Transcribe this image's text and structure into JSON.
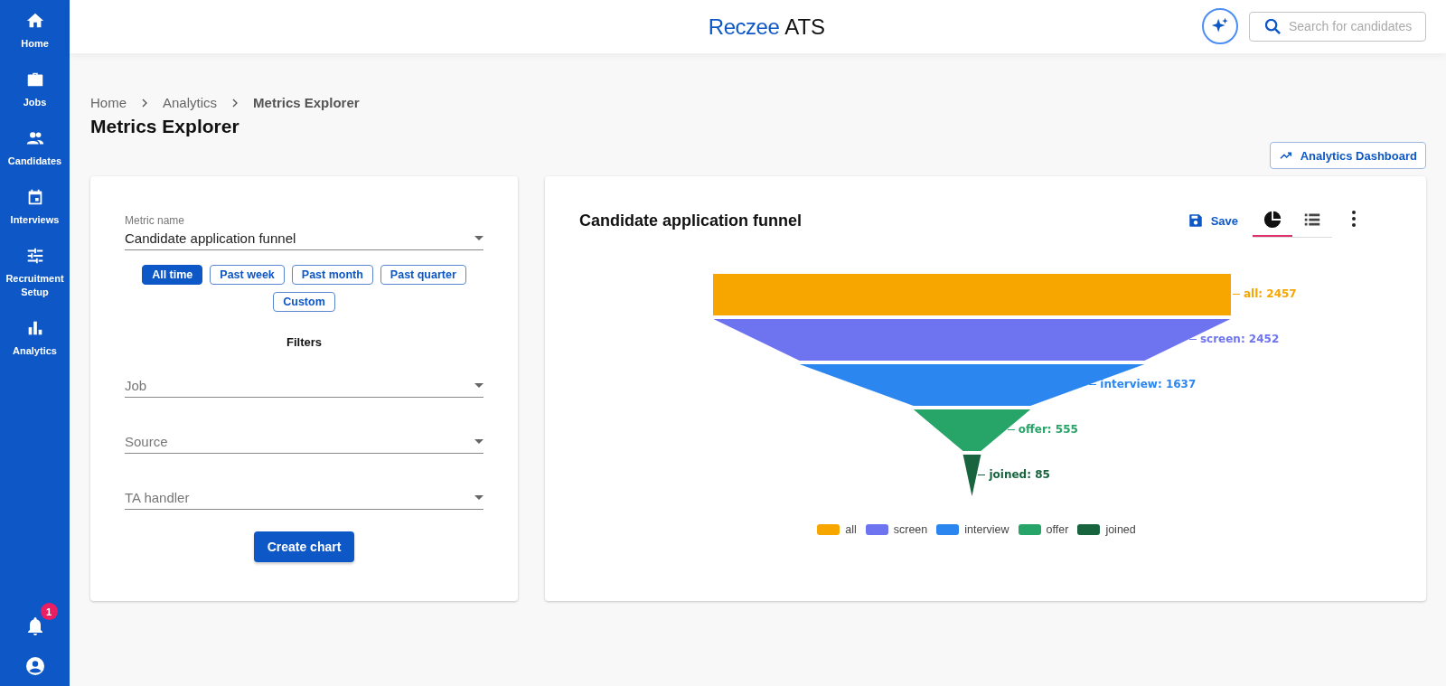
{
  "sidebar": {
    "items": [
      {
        "label": "Home",
        "kind": "home"
      },
      {
        "label": "Jobs",
        "kind": "jobs"
      },
      {
        "label": "Candidates",
        "kind": "candidates"
      },
      {
        "label": "Interviews",
        "kind": "interviews"
      },
      {
        "label": "Recruitment Setup",
        "kind": "setup"
      },
      {
        "label": "Analytics",
        "kind": "analytics"
      }
    ],
    "notifications": {
      "badge": "1"
    }
  },
  "header": {
    "logo": {
      "brand": "Reczee",
      "product": "ATS"
    },
    "search": {
      "placeholder": "Search for candidates"
    }
  },
  "breadcrumb": [
    {
      "label": "Home",
      "current": false
    },
    {
      "label": "Analytics",
      "current": false
    },
    {
      "label": "Metrics Explorer",
      "current": true
    }
  ],
  "page_title": "Metrics Explorer",
  "dashboard_button": "Analytics Dashboard",
  "metric_form": {
    "metric_field": {
      "label": "Metric name",
      "value": "Candidate application funnel"
    },
    "ranges": [
      {
        "label": "All time",
        "selected": true
      },
      {
        "label": "Past week",
        "selected": false
      },
      {
        "label": "Past month",
        "selected": false
      },
      {
        "label": "Past quarter",
        "selected": false
      },
      {
        "label": "Custom",
        "selected": false
      }
    ],
    "filters_title": "Filters",
    "filters": [
      {
        "placeholder": "Job"
      },
      {
        "placeholder": "Source"
      },
      {
        "placeholder": "TA handler"
      }
    ],
    "submit": "Create chart"
  },
  "chart_panel": {
    "title": "Candidate application funnel",
    "save": "Save",
    "view_tabs": [
      {
        "kind": "chart",
        "selected": true
      },
      {
        "kind": "table",
        "selected": false
      }
    ],
    "funnel": {
      "stages": [
        {
          "kind": "bar",
          "label": "all: 2457",
          "color": "#f7a600"
        },
        {
          "kind": "taper",
          "label": "screen: 2452",
          "color": "#6e74ef"
        },
        {
          "kind": "taper",
          "label": "interview: 1637",
          "color": "#2b86f0"
        },
        {
          "kind": "taper",
          "label": "offer: 555",
          "color": "#27a468"
        },
        {
          "kind": "taper",
          "label": "joined: 85",
          "color": "#17643f"
        }
      ],
      "legend": [
        {
          "label": "all",
          "color": "#f7a600"
        },
        {
          "label": "screen",
          "color": "#6e74ef"
        },
        {
          "label": "interview",
          "color": "#2b86f0"
        },
        {
          "label": "offer",
          "color": "#27a468"
        },
        {
          "label": "joined",
          "color": "#17643f"
        }
      ]
    }
  }
}
